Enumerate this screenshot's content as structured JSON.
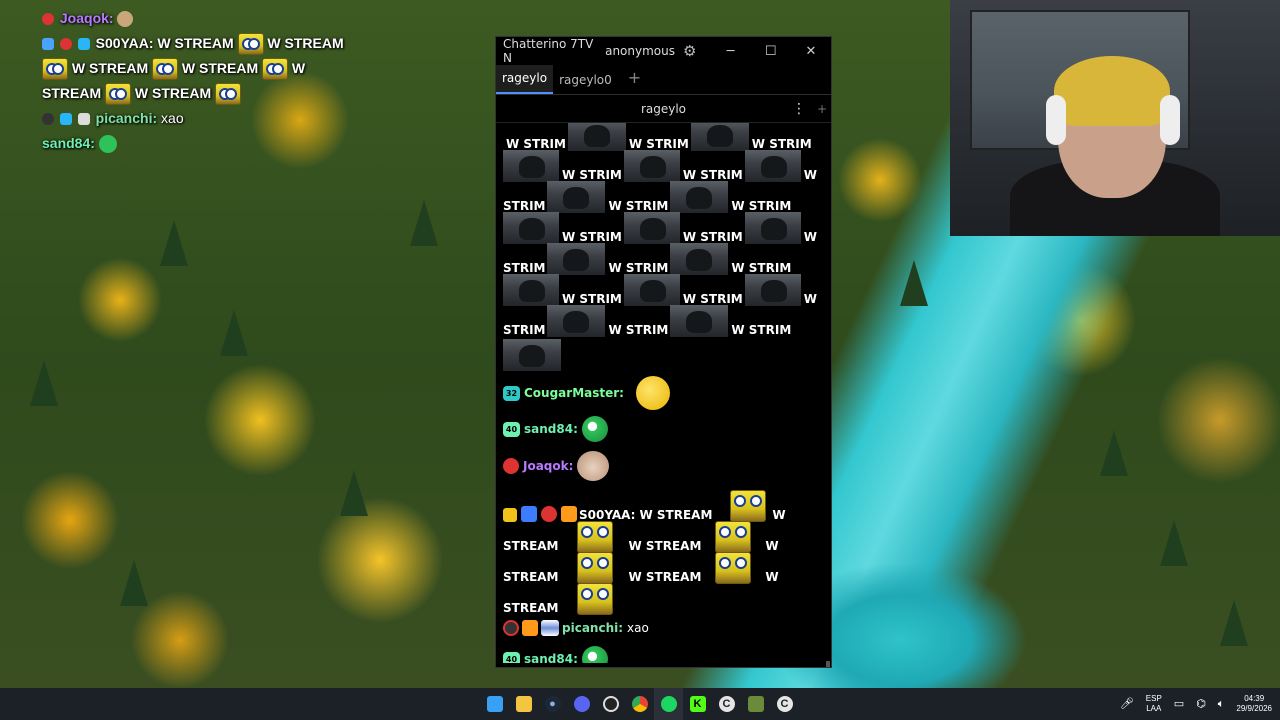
{
  "overlay_chat": {
    "line1_user": "Joaqok:",
    "line2_user": "S00YAA:",
    "stream_text": "W STREAM",
    "w_text": "W",
    "stream_word": "STREAM",
    "line5_user": "picanchi:",
    "line5_text": "xao",
    "line6_user": "sand84:"
  },
  "chatterino": {
    "app_title": "Chatterino 7TV N",
    "account": "anonymous",
    "tabs": [
      {
        "label": "rageylo"
      },
      {
        "label": "rageylo0"
      }
    ],
    "tab_add": "+",
    "channel": "rageylo",
    "strim_text": "W STRIM",
    "strim_w": "W",
    "strim_word": "STRIM",
    "messages": {
      "cougar_badge": "32",
      "cougar_user": "CougarMaster:",
      "sand_badge": "40",
      "sand_user": "sand84:",
      "joaqok_user": "Joaqok:",
      "s00yaa_user": "S00YAA:",
      "stream_text": "W STREAM",
      "w_text": "W",
      "stream_word": "STREAM",
      "picanchi_user": "picanchi:",
      "picanchi_text": "xao",
      "sand2_badge": "40",
      "sand2_user": "sand84:"
    }
  },
  "colors": {
    "joaqok": "#b77aff",
    "s00yaa": "#ffffff",
    "cougar": "#7cff9a",
    "sand": "#6ef0b0",
    "picanchi": "#7fe3a9",
    "accent": "#4d90fe"
  },
  "taskbar": {
    "icons": [
      "windows-icon",
      "file-explorer-icon",
      "steam-icon",
      "discord-icon",
      "obs-icon",
      "chrome-icon",
      "spotify-icon",
      "kick-icon",
      "chatterino-icon",
      "minecraft-icon",
      "chatterino-alt-icon"
    ],
    "lang_top": "ESP",
    "lang_bottom": "LAA",
    "time": "04:39",
    "date": "29/9/2026"
  }
}
